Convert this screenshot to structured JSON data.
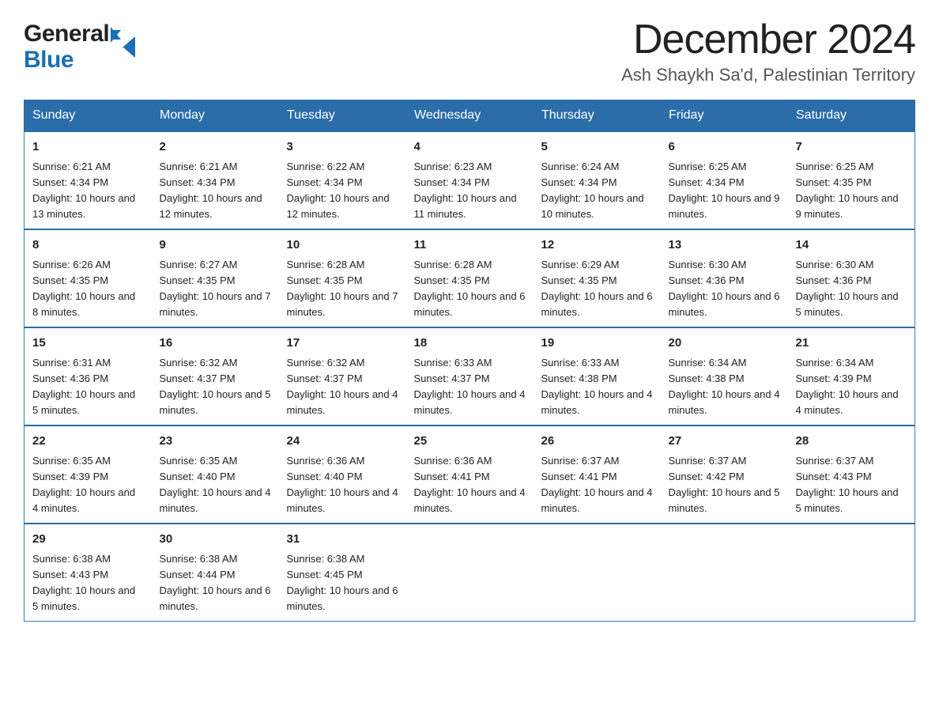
{
  "logo": {
    "general": "General",
    "blue": "Blue"
  },
  "title": {
    "month_year": "December 2024",
    "location": "Ash Shaykh Sa'd, Palestinian Territory"
  },
  "headers": [
    "Sunday",
    "Monday",
    "Tuesday",
    "Wednesday",
    "Thursday",
    "Friday",
    "Saturday"
  ],
  "weeks": [
    [
      {
        "day": "1",
        "sunrise": "6:21 AM",
        "sunset": "4:34 PM",
        "daylight": "10 hours and 13 minutes."
      },
      {
        "day": "2",
        "sunrise": "6:21 AM",
        "sunset": "4:34 PM",
        "daylight": "10 hours and 12 minutes."
      },
      {
        "day": "3",
        "sunrise": "6:22 AM",
        "sunset": "4:34 PM",
        "daylight": "10 hours and 12 minutes."
      },
      {
        "day": "4",
        "sunrise": "6:23 AM",
        "sunset": "4:34 PM",
        "daylight": "10 hours and 11 minutes."
      },
      {
        "day": "5",
        "sunrise": "6:24 AM",
        "sunset": "4:34 PM",
        "daylight": "10 hours and 10 minutes."
      },
      {
        "day": "6",
        "sunrise": "6:25 AM",
        "sunset": "4:34 PM",
        "daylight": "10 hours and 9 minutes."
      },
      {
        "day": "7",
        "sunrise": "6:25 AM",
        "sunset": "4:35 PM",
        "daylight": "10 hours and 9 minutes."
      }
    ],
    [
      {
        "day": "8",
        "sunrise": "6:26 AM",
        "sunset": "4:35 PM",
        "daylight": "10 hours and 8 minutes."
      },
      {
        "day": "9",
        "sunrise": "6:27 AM",
        "sunset": "4:35 PM",
        "daylight": "10 hours and 7 minutes."
      },
      {
        "day": "10",
        "sunrise": "6:28 AM",
        "sunset": "4:35 PM",
        "daylight": "10 hours and 7 minutes."
      },
      {
        "day": "11",
        "sunrise": "6:28 AM",
        "sunset": "4:35 PM",
        "daylight": "10 hours and 6 minutes."
      },
      {
        "day": "12",
        "sunrise": "6:29 AM",
        "sunset": "4:35 PM",
        "daylight": "10 hours and 6 minutes."
      },
      {
        "day": "13",
        "sunrise": "6:30 AM",
        "sunset": "4:36 PM",
        "daylight": "10 hours and 6 minutes."
      },
      {
        "day": "14",
        "sunrise": "6:30 AM",
        "sunset": "4:36 PM",
        "daylight": "10 hours and 5 minutes."
      }
    ],
    [
      {
        "day": "15",
        "sunrise": "6:31 AM",
        "sunset": "4:36 PM",
        "daylight": "10 hours and 5 minutes."
      },
      {
        "day": "16",
        "sunrise": "6:32 AM",
        "sunset": "4:37 PM",
        "daylight": "10 hours and 5 minutes."
      },
      {
        "day": "17",
        "sunrise": "6:32 AM",
        "sunset": "4:37 PM",
        "daylight": "10 hours and 4 minutes."
      },
      {
        "day": "18",
        "sunrise": "6:33 AM",
        "sunset": "4:37 PM",
        "daylight": "10 hours and 4 minutes."
      },
      {
        "day": "19",
        "sunrise": "6:33 AM",
        "sunset": "4:38 PM",
        "daylight": "10 hours and 4 minutes."
      },
      {
        "day": "20",
        "sunrise": "6:34 AM",
        "sunset": "4:38 PM",
        "daylight": "10 hours and 4 minutes."
      },
      {
        "day": "21",
        "sunrise": "6:34 AM",
        "sunset": "4:39 PM",
        "daylight": "10 hours and 4 minutes."
      }
    ],
    [
      {
        "day": "22",
        "sunrise": "6:35 AM",
        "sunset": "4:39 PM",
        "daylight": "10 hours and 4 minutes."
      },
      {
        "day": "23",
        "sunrise": "6:35 AM",
        "sunset": "4:40 PM",
        "daylight": "10 hours and 4 minutes."
      },
      {
        "day": "24",
        "sunrise": "6:36 AM",
        "sunset": "4:40 PM",
        "daylight": "10 hours and 4 minutes."
      },
      {
        "day": "25",
        "sunrise": "6:36 AM",
        "sunset": "4:41 PM",
        "daylight": "10 hours and 4 minutes."
      },
      {
        "day": "26",
        "sunrise": "6:37 AM",
        "sunset": "4:41 PM",
        "daylight": "10 hours and 4 minutes."
      },
      {
        "day": "27",
        "sunrise": "6:37 AM",
        "sunset": "4:42 PM",
        "daylight": "10 hours and 5 minutes."
      },
      {
        "day": "28",
        "sunrise": "6:37 AM",
        "sunset": "4:43 PM",
        "daylight": "10 hours and 5 minutes."
      }
    ],
    [
      {
        "day": "29",
        "sunrise": "6:38 AM",
        "sunset": "4:43 PM",
        "daylight": "10 hours and 5 minutes."
      },
      {
        "day": "30",
        "sunrise": "6:38 AM",
        "sunset": "4:44 PM",
        "daylight": "10 hours and 6 minutes."
      },
      {
        "day": "31",
        "sunrise": "6:38 AM",
        "sunset": "4:45 PM",
        "daylight": "10 hours and 6 minutes."
      },
      null,
      null,
      null,
      null
    ]
  ],
  "labels": {
    "sunrise": "Sunrise: ",
    "sunset": "Sunset: ",
    "daylight": "Daylight: "
  }
}
